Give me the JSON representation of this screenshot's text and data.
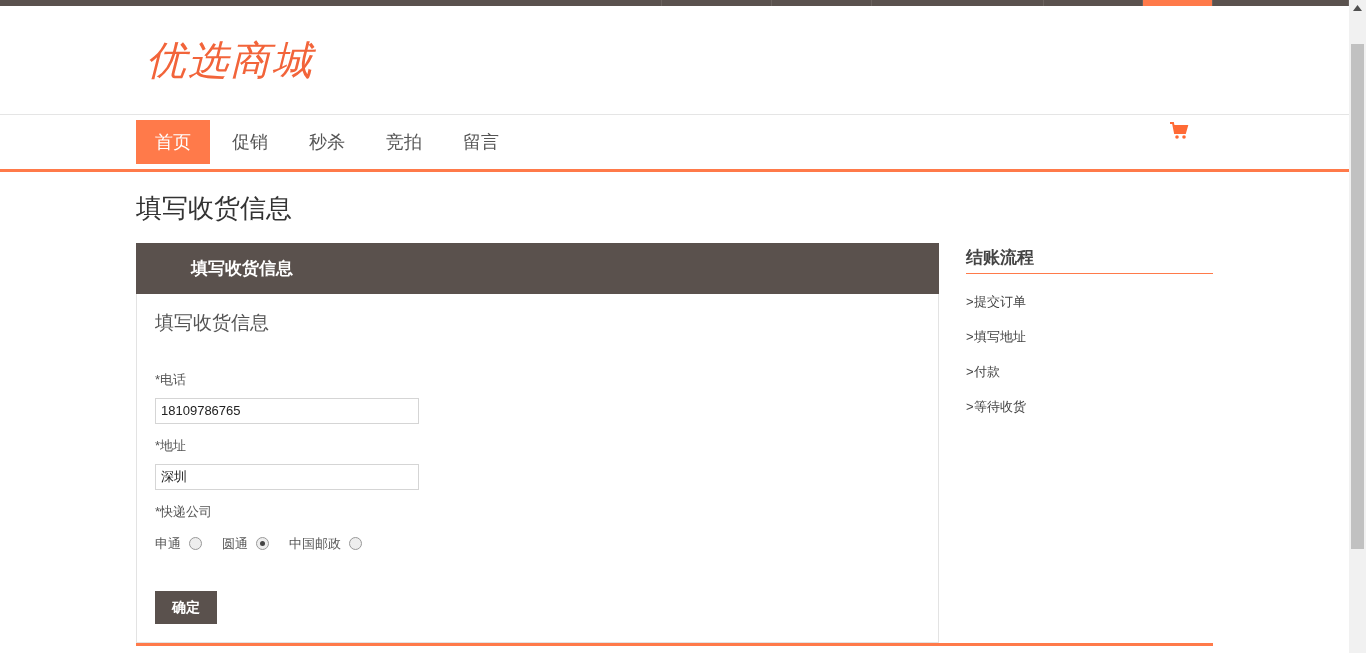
{
  "top_bar": {
    "segments": [
      {
        "selected": false
      },
      {
        "selected": false
      },
      {
        "selected": false
      },
      {
        "selected": false
      },
      {
        "selected": false
      },
      {
        "selected": true
      },
      {
        "selected": false
      }
    ]
  },
  "logo": {
    "text": "优选商城"
  },
  "nav": {
    "items": [
      {
        "label": "首页",
        "selected": true
      },
      {
        "label": "促销",
        "selected": false
      },
      {
        "label": "秒杀",
        "selected": false
      },
      {
        "label": "竞拍",
        "selected": false
      },
      {
        "label": "留言",
        "selected": false
      }
    ]
  },
  "page_title": "填写收货信息",
  "panel": {
    "header": "填写收货信息",
    "title": "填写收货信息",
    "fields": [
      {
        "label": "*电话",
        "value": "18109786765"
      },
      {
        "label": "*地址",
        "value": "深圳"
      }
    ],
    "courier": {
      "label": "*快递公司",
      "options": [
        {
          "label": "申通",
          "selected": false
        },
        {
          "label": "圆通",
          "selected": true
        },
        {
          "label": "中国邮政",
          "selected": false
        }
      ]
    },
    "submit": "确定"
  },
  "sidebar": {
    "title": "结账流程",
    "steps": [
      ">提交订单",
      ">填写地址",
      ">付款",
      ">等待收货"
    ]
  }
}
